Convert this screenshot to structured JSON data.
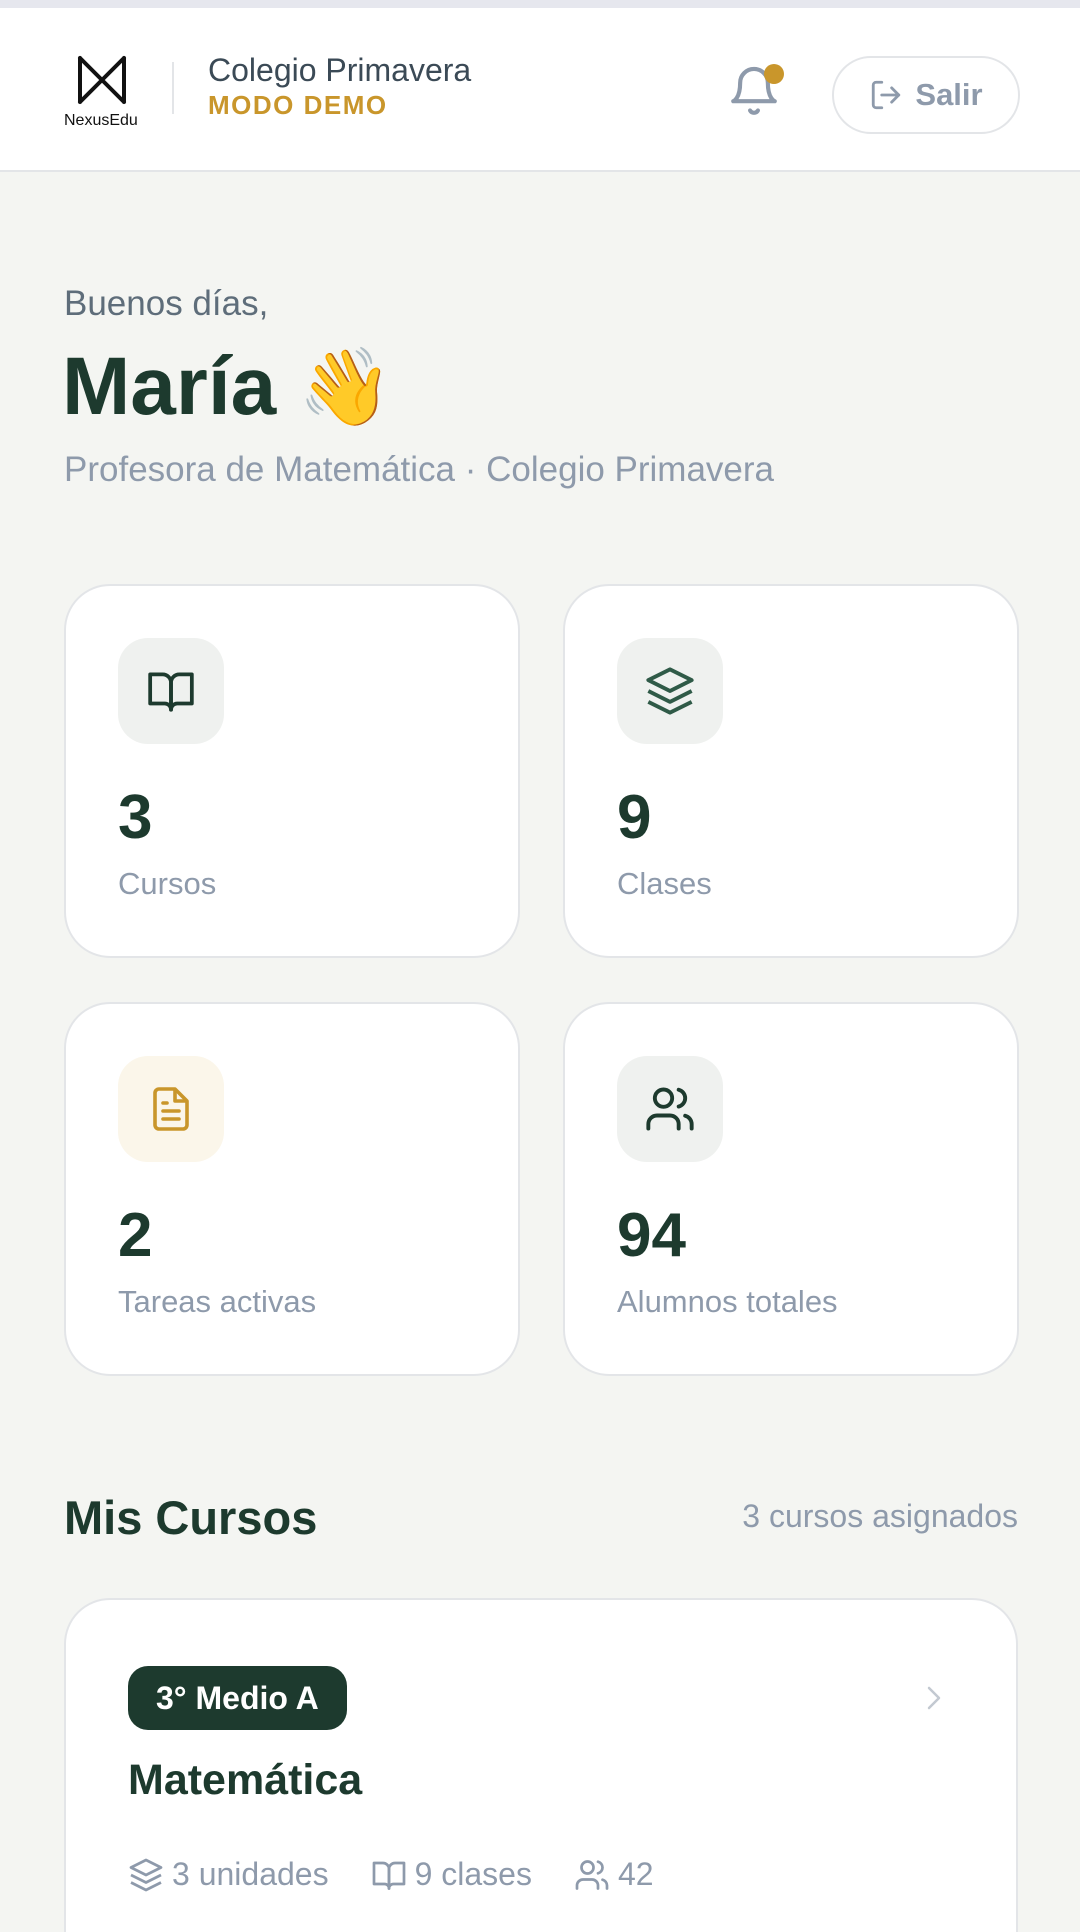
{
  "header": {
    "logo_text": "NexusEdu",
    "school_name": "Colegio Primavera",
    "mode_label": "MODO DEMO",
    "logout_label": "Salir",
    "notification_dot_color": "#c9962b"
  },
  "welcome": {
    "greeting": "Buenos días,",
    "name": "María",
    "emoji": "👋",
    "subtitle": "Profesora de Matemática · Colegio Primavera"
  },
  "stats": [
    {
      "value": "3",
      "label": "Cursos",
      "icon": "book-open-icon"
    },
    {
      "value": "9",
      "label": "Clases",
      "icon": "layers-icon"
    },
    {
      "value": "2",
      "label": "Tareas activas",
      "icon": "file-text-icon"
    },
    {
      "value": "94",
      "label": "Alumnos totales",
      "icon": "users-icon"
    }
  ],
  "courses_section": {
    "title": "Mis Cursos",
    "meta": "3 cursos asignados",
    "courses": [
      {
        "badge": "3° Medio A",
        "title": "Matemática",
        "units": "3 unidades",
        "classes": "9 clases",
        "students": "42"
      }
    ]
  },
  "colors": {
    "brand_dark": "#1d3a2e",
    "accent_gold": "#c9962b",
    "muted": "#8e9aab",
    "background": "#f4f5f2"
  }
}
